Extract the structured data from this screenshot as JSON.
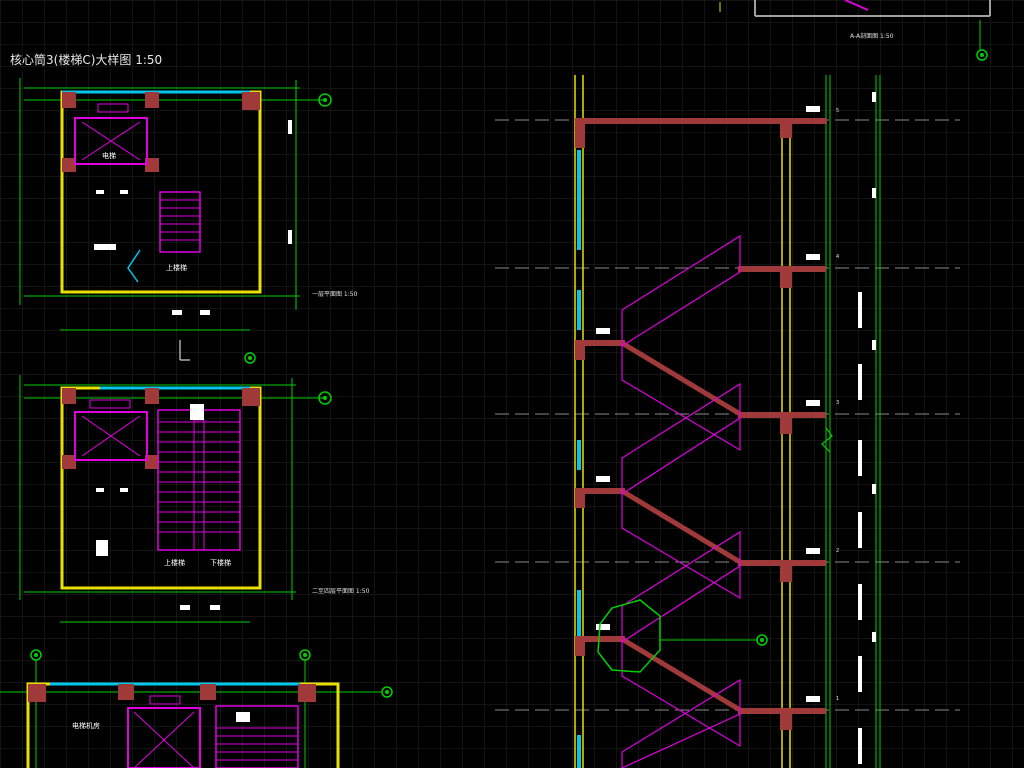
{
  "drawing": {
    "title": "核心筒3(楼梯C)大样图  1:50",
    "top_caption": "A-A剖面图  1:50",
    "plan1_caption": "一层平面图  1:50",
    "plan2_caption": "二至四层平面图  1:50",
    "room_elevator_1": "电梯",
    "room_up_1": "上楼梯",
    "room_up_2": "上楼梯",
    "room_down_2": "下楼梯",
    "room_machine": "电梯机房",
    "level_marks": [
      "5",
      "4",
      "3",
      "2",
      "1"
    ]
  },
  "colors": {
    "background": "#000000",
    "grid": "#2a2a2a",
    "wall_yellow": "#e8e000",
    "column_red": "#a03a3a",
    "stair_magenta": "#e000e0",
    "green_line": "#00d000",
    "cyan_window": "#00c8e8",
    "white": "#ffffff",
    "dim_grey": "#8a8a8a"
  }
}
